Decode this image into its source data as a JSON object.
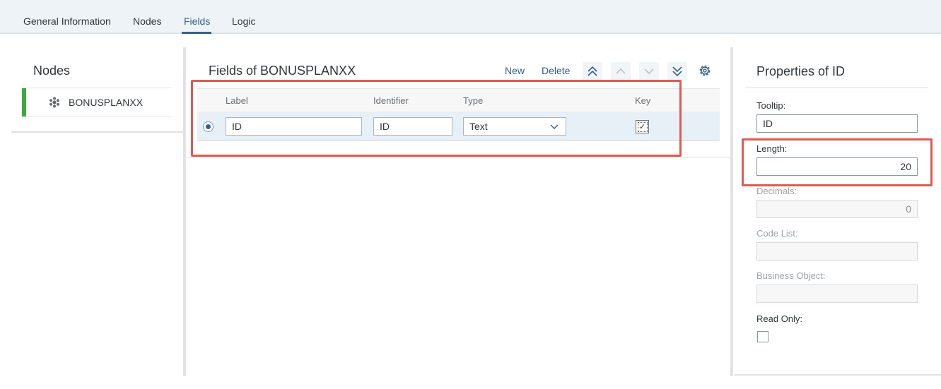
{
  "tabs": [
    {
      "label": "General Information"
    },
    {
      "label": "Nodes"
    },
    {
      "label": "Fields",
      "active": true
    },
    {
      "label": "Logic"
    }
  ],
  "colors": {
    "accent": "#346187",
    "node_bar": "#3caa3c",
    "highlight": "#e05a4f"
  },
  "nodes": {
    "title": "Nodes",
    "items": [
      {
        "label": "BONUSPLANXX",
        "icon": "node-hierarchy-icon"
      }
    ]
  },
  "fields": {
    "title": "Fields of BONUSPLANXX",
    "toolbar": {
      "new_label": "New",
      "delete_label": "Delete",
      "icons": [
        "move-top-icon",
        "move-up-icon",
        "move-down-icon",
        "move-bottom-icon",
        "settings-gear-icon"
      ]
    },
    "columns": [
      "Label",
      "Identifier",
      "Type",
      "Key"
    ],
    "rows": [
      {
        "selected": true,
        "label": "ID",
        "identifier": "ID",
        "type": "Text",
        "key": true
      }
    ]
  },
  "properties": {
    "title": "Properties of ID",
    "tooltip_label": "Tooltip:",
    "tooltip_value": "ID",
    "length_label": "Length:",
    "length_value": "20",
    "decimals_label": "Decimals:",
    "decimals_value": "0",
    "code_list_label": "Code List:",
    "code_list_value": "",
    "business_object_label": "Business Object:",
    "business_object_value": "",
    "read_only_label": "Read Only:",
    "read_only_checked": false
  }
}
